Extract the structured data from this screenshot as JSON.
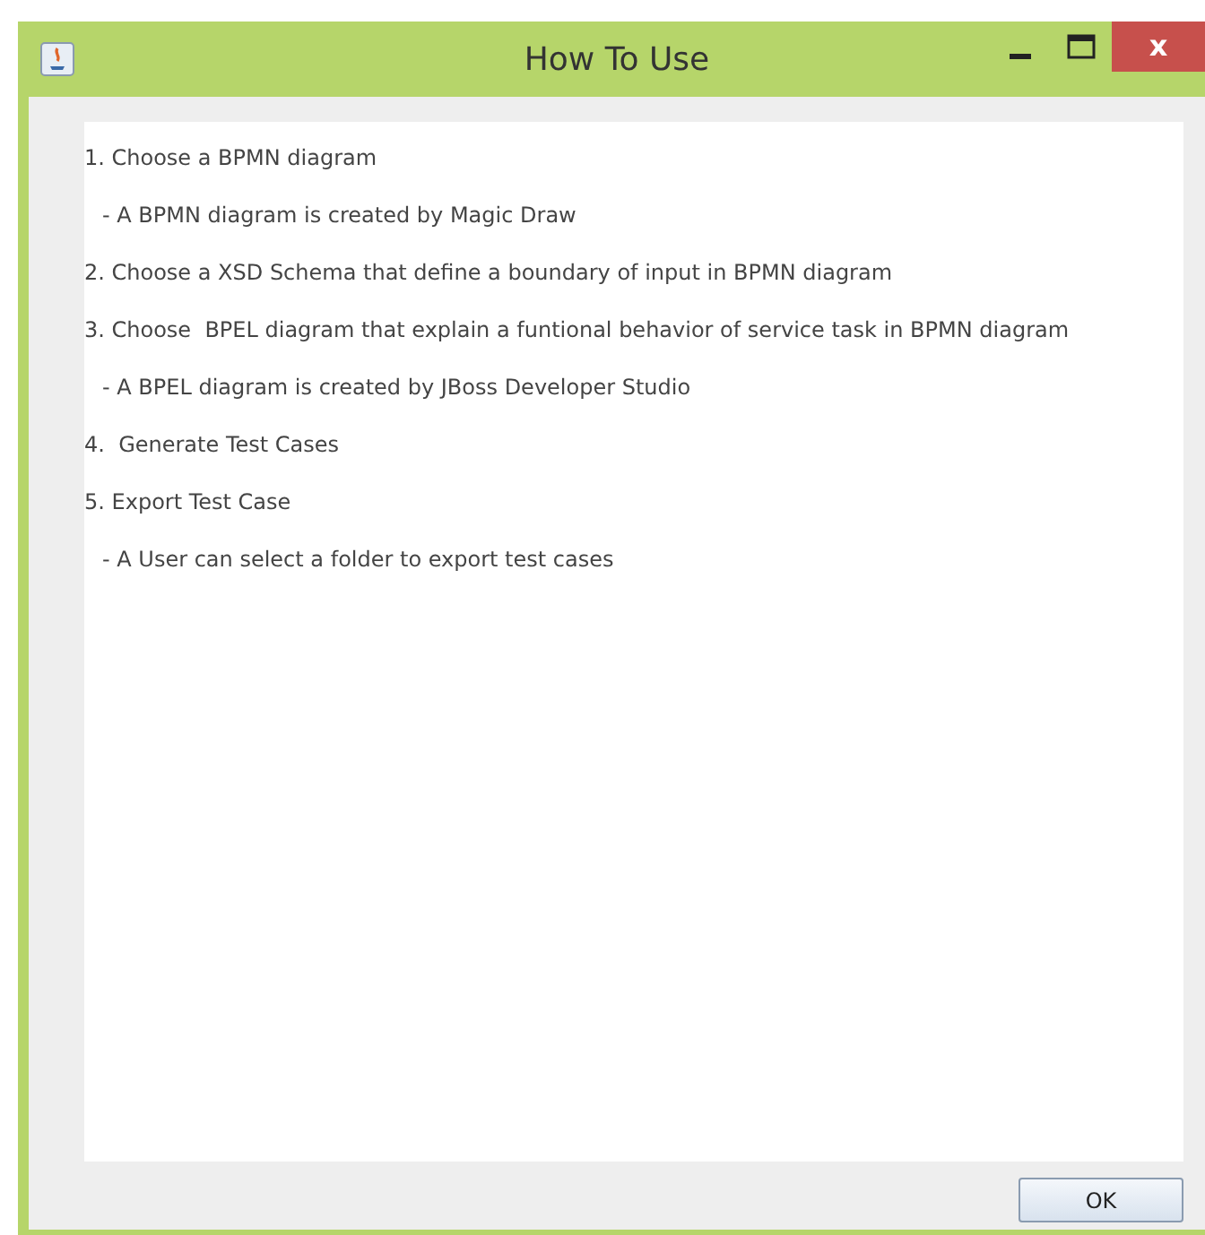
{
  "window": {
    "title": "How To Use",
    "close_glyph": "x"
  },
  "lines": [
    {
      "text": "1. Choose a BPMN diagram",
      "kind": "step"
    },
    {
      "text": "- A BPMN diagram is created by Magic Draw",
      "kind": "note"
    },
    {
      "text": "2. Choose a XSD Schema that define a boundary of input in BPMN diagram",
      "kind": "step"
    },
    {
      "text": "3. Choose  BPEL diagram that explain a funtional behavior of service task in BPMN diagram",
      "kind": "step"
    },
    {
      "text": "- A BPEL diagram is created by JBoss Developer Studio",
      "kind": "note"
    },
    {
      "text": "4.  Generate Test Cases",
      "kind": "step"
    },
    {
      "text": "5. Export Test Case",
      "kind": "step"
    },
    {
      "text": "- A User can select a folder to export test cases",
      "kind": "note"
    }
  ],
  "ok_button": "OK"
}
